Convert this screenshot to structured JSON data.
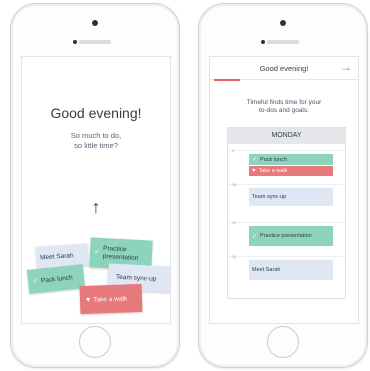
{
  "left_screen": {
    "greeting": "Good evening!",
    "subtitle_line1": "So much to do,",
    "subtitle_line2": "so little time?",
    "arrow": "↑",
    "cards": {
      "meet": "Meet Sarah",
      "pack": "Pack lunch",
      "practice_line1": "Practice",
      "practice_line2": "presentation",
      "team": "Team sync-up",
      "walk": "Take a walk"
    }
  },
  "right_screen": {
    "header_title": "Good evening!",
    "header_arrow": "→",
    "info_line1": "Timeful finds time for your",
    "info_line2": "to-dos and goals.",
    "calendar": {
      "day": "MONDAY",
      "hours": [
        "9",
        "10",
        "11",
        "12"
      ],
      "events": {
        "pack": "Pack lunch",
        "walk": "Take a walk",
        "team": "Team sync-up",
        "practice": "Practice presentation",
        "meet": "Meet Sarah"
      }
    }
  },
  "icons": {
    "check": "✓",
    "heart": "♥"
  },
  "colors": {
    "green": "#8ed4bd",
    "red": "#e7787b",
    "blue": "#dfe7f5",
    "accent": "#e45c64"
  }
}
